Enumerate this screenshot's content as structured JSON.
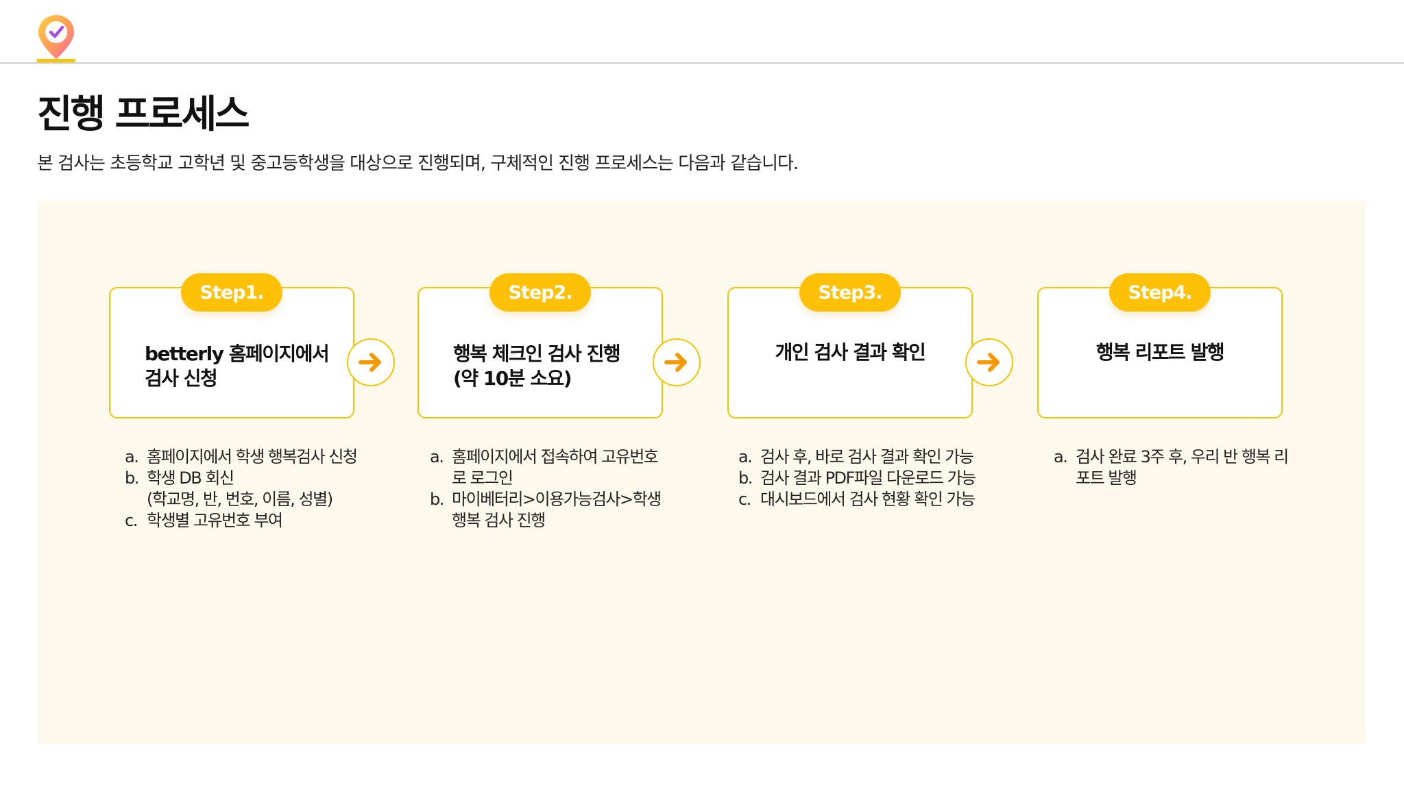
{
  "page": {
    "title": "진행 프로세스",
    "subtitle": "본 검사는 초등학교 고학년 및 중고등학생을 대상으로 진행되며, 구체적인 진행 프로세스는 다음과 같습니다."
  },
  "logo": {
    "icon": "location-pin-check-icon"
  },
  "colors": {
    "accent": "#ffc107",
    "border": "#f5c400",
    "arrow": "#f39a00",
    "panel_bg": "#fdf9ec"
  },
  "steps": [
    {
      "label": "Step1.",
      "title_lines": [
        "betterly 홈페이지에서",
        "검사 신청"
      ],
      "items": [
        {
          "marker": "a.",
          "lines": [
            "홈페이지에서 학생 행복검사 신청"
          ]
        },
        {
          "marker": "b.",
          "lines": [
            "학생 DB 회신",
            "(학교명, 반, 번호, 이름, 성별)"
          ]
        },
        {
          "marker": "c.",
          "lines": [
            "학생별 고유번호 부여"
          ]
        }
      ]
    },
    {
      "label": "Step2.",
      "title_lines": [
        "행복 체크인 검사 진행",
        "(약 10분 소요)"
      ],
      "items": [
        {
          "marker": "a.",
          "lines": [
            "홈페이지에서 접속하여 고유번호",
            "로 로그인"
          ]
        },
        {
          "marker": "b.",
          "lines": [
            "마이베터리>이용가능검사>학생",
            "행복 검사 진행"
          ]
        }
      ]
    },
    {
      "label": "Step3.",
      "title_lines": [
        "개인 검사 결과 확인"
      ],
      "items": [
        {
          "marker": "a.",
          "lines": [
            "검사 후, 바로 검사 결과 확인 가능"
          ]
        },
        {
          "marker": "b.",
          "lines": [
            "검사 결과 PDF파일 다운로드 가능"
          ]
        },
        {
          "marker": "c.",
          "lines": [
            "대시보드에서 검사 현황 확인 가능"
          ]
        }
      ]
    },
    {
      "label": "Step4.",
      "title_lines": [
        "행복 리포트 발행"
      ],
      "items": [
        {
          "marker": "a.",
          "lines": [
            "검사 완료 3주 후, 우리 반 행복 리",
            "포트 발행"
          ]
        }
      ]
    }
  ],
  "arrows": [
    "arrow-right-icon",
    "arrow-right-icon",
    "arrow-right-icon"
  ]
}
